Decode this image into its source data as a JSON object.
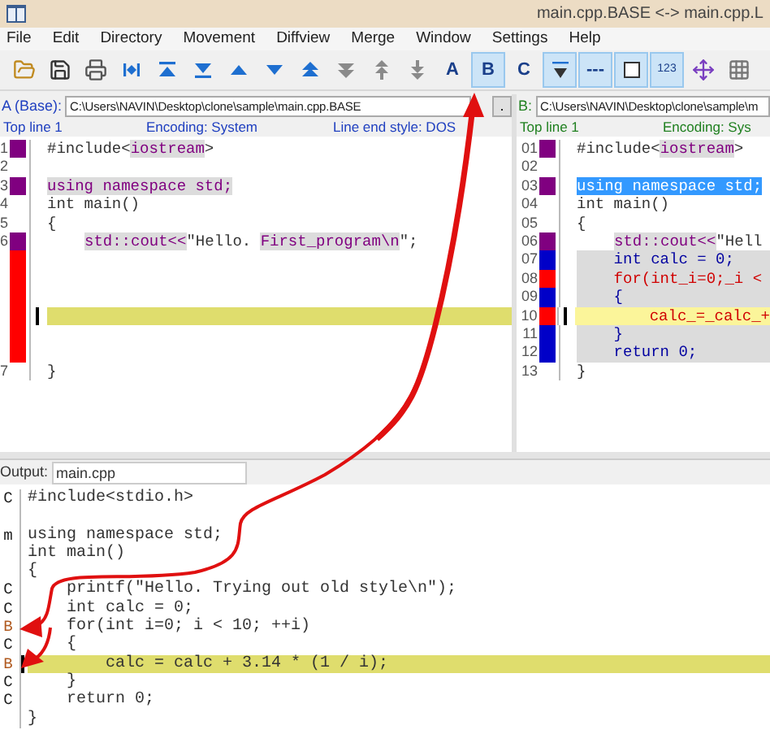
{
  "window": {
    "title": "main.cpp.BASE <-> main.cpp.L"
  },
  "menu": [
    "File",
    "Edit",
    "Directory",
    "Movement",
    "Diffview",
    "Merge",
    "Window",
    "Settings",
    "Help"
  ],
  "toolbar": [
    {
      "kind": "open",
      "selected": false
    },
    {
      "kind": "save",
      "selected": false
    },
    {
      "kind": "print",
      "selected": false
    },
    {
      "kind": "current",
      "selected": false
    },
    {
      "kind": "top",
      "selected": false
    },
    {
      "kind": "bottom",
      "selected": false
    },
    {
      "kind": "prev",
      "selected": false
    },
    {
      "kind": "next",
      "selected": false
    },
    {
      "kind": "prev-conflict",
      "selected": false
    },
    {
      "kind": "next-conflict",
      "selected": false
    },
    {
      "kind": "prev-unsolved",
      "selected": false
    },
    {
      "kind": "next-unsolved",
      "selected": false
    },
    {
      "kind": "letter",
      "label": "A",
      "selected": false
    },
    {
      "kind": "letter",
      "label": "B",
      "selected": true
    },
    {
      "kind": "letter",
      "label": "C",
      "selected": false
    },
    {
      "kind": "auto",
      "selected": true
    },
    {
      "kind": "letter",
      "label": "---",
      "selected": true
    },
    {
      "kind": "square",
      "selected": true
    },
    {
      "kind": "small",
      "label": "123",
      "selected": true
    },
    {
      "kind": "move",
      "selected": false
    },
    {
      "kind": "grid",
      "selected": false
    }
  ],
  "pane_a": {
    "label": "A (Base):",
    "path": "C:\\Users\\NAVIN\\Desktop\\clone\\sample\\main.cpp.BASE",
    "browse": ".",
    "top_line": "Top line 1",
    "encoding": "Encoding: System",
    "line_end": "Line end style: DOS",
    "lines": [
      {
        "number": "1",
        "color": "#800080",
        "current": false,
        "shaded": false,
        "indented": false,
        "segments": [
          {
            "text": "#include<",
            "kind": "plain"
          },
          {
            "text": "iostream",
            "kind": "diff"
          },
          {
            "text": ">",
            "kind": "plain"
          }
        ]
      },
      {
        "number": "2",
        "current": false,
        "shaded": false
      },
      {
        "number": "3",
        "color": "#800080",
        "current": false,
        "shaded": false,
        "indented": false,
        "segments": [
          {
            "text": "using namespace std;",
            "kind": "diff"
          }
        ]
      },
      {
        "number": "4",
        "current": false,
        "shaded": false,
        "indented": false,
        "segments": [
          {
            "text": "int main()",
            "kind": "plain"
          }
        ]
      },
      {
        "number": "5",
        "current": false,
        "shaded": false,
        "indented": false,
        "segments": [
          {
            "text": "{",
            "kind": "plain"
          }
        ]
      },
      {
        "number": "6",
        "color": "#800080",
        "current": false,
        "shaded": false,
        "indented": true,
        "segments": [
          {
            "text": "std::cout<<",
            "kind": "diff"
          },
          {
            "text": "\"Hello. ",
            "kind": "plain"
          },
          {
            "text": "First_program\\n",
            "kind": "diff"
          },
          {
            "text": "\";",
            "kind": "plain"
          }
        ]
      },
      {
        "color": "#ff0000",
        "current": false,
        "shaded": false
      },
      {
        "color": "#ff0000",
        "current": false,
        "shaded": false
      },
      {
        "color": "#ff0000",
        "current": false,
        "shaded": false
      },
      {
        "color": "#ff0000",
        "current": true,
        "shaded": false
      },
      {
        "color": "#ff0000",
        "current": false,
        "shaded": false
      },
      {
        "color": "#ff0000",
        "current": false,
        "shaded": false
      },
      {
        "number": "7",
        "current": false,
        "shaded": false,
        "indented": false,
        "segments": [
          {
            "text": "}",
            "kind": "plain"
          }
        ]
      }
    ]
  },
  "pane_b": {
    "label": "B:",
    "path": "C:\\Users\\NAVIN\\Desktop\\clone\\sample\\m",
    "top_line": "Top line 1",
    "encoding": "Encoding: Sys",
    "lines": [
      {
        "number": "01",
        "color": "#800080",
        "current": false,
        "shaded": false,
        "indented": false,
        "segments": [
          {
            "text": "#include<",
            "kind": "plain"
          },
          {
            "text": "iostream",
            "kind": "diff"
          },
          {
            "text": ">",
            "kind": "plain"
          }
        ]
      },
      {
        "number": "02",
        "current": false,
        "shaded": false
      },
      {
        "number": "03",
        "color": "#800080",
        "current": false,
        "shaded": false,
        "indented": false,
        "segments": [
          {
            "text": "using namespace std;",
            "kind": "selection"
          }
        ]
      },
      {
        "number": "04",
        "current": false,
        "shaded": false,
        "indented": false,
        "segments": [
          {
            "text": "int main()",
            "kind": "plain"
          }
        ]
      },
      {
        "number": "05",
        "current": false,
        "shaded": false,
        "indented": false,
        "segments": [
          {
            "text": "{",
            "kind": "plain"
          }
        ]
      },
      {
        "number": "06",
        "color": "#800080",
        "current": false,
        "shaded": false,
        "indented": true,
        "segments": [
          {
            "text": "std::cout<<",
            "kind": "diff"
          },
          {
            "text": "\"Hell",
            "kind": "plain"
          }
        ]
      },
      {
        "number": "07",
        "color": "#0000c8",
        "current": false,
        "shaded": true,
        "indented": false,
        "segments": [
          {
            "text": "    int calc = 0;",
            "kind": "added"
          }
        ]
      },
      {
        "number": "08",
        "color": "#ff0000",
        "current": false,
        "shaded": true,
        "indented": false,
        "segments": [
          {
            "text": "    for(int_i=0;_i <",
            "kind": "conflict"
          }
        ]
      },
      {
        "number": "09",
        "color": "#0000c8",
        "current": false,
        "shaded": true,
        "indented": false,
        "segments": [
          {
            "text": "    {",
            "kind": "added"
          }
        ]
      },
      {
        "number": "10",
        "color": "#ff0000",
        "current": true,
        "shaded": true,
        "indented": false,
        "segments": [
          {
            "text": "        calc_=_calc_+",
            "kind": "conflict"
          }
        ]
      },
      {
        "number": "11",
        "color": "#0000c8",
        "current": false,
        "shaded": true,
        "indented": false,
        "segments": [
          {
            "text": "    }",
            "kind": "added"
          }
        ]
      },
      {
        "number": "12",
        "color": "#0000c8",
        "current": false,
        "shaded": true,
        "indented": false,
        "segments": [
          {
            "text": "    return 0;",
            "kind": "added"
          }
        ]
      },
      {
        "number": "13",
        "current": false,
        "shaded": false,
        "indented": false,
        "segments": [
          {
            "text": "}",
            "kind": "plain"
          }
        ]
      }
    ]
  },
  "output": {
    "label": "Output:",
    "file": "main.cpp",
    "lines": [
      {
        "source": "C",
        "color": "#202020",
        "text": "#include<stdio.h>",
        "current": false
      },
      {
        "current": false
      },
      {
        "source": "m",
        "color": "#202020",
        "text": "using namespace std;",
        "current": false
      },
      {
        "text": "int main()",
        "current": false
      },
      {
        "text": "{",
        "current": false
      },
      {
        "source": "C",
        "color": "#202020",
        "text": "    printf(\"Hello. Trying out old style\\n\");",
        "current": false
      },
      {
        "source": "C",
        "color": "#202020",
        "text": "    int calc = 0;",
        "current": false
      },
      {
        "source": "B",
        "color": "#b05a20",
        "text": "    for(int i=0; i < 10; ++i)",
        "current": false
      },
      {
        "source": "C",
        "color": "#202020",
        "text": "    {",
        "current": false
      },
      {
        "source": "B",
        "color": "#b05a20",
        "text": "        calc = calc + 3.14 * (1 / i);",
        "current": true
      },
      {
        "source": "C",
        "color": "#202020",
        "text": "    }",
        "current": false
      },
      {
        "source": "C",
        "color": "#202020",
        "text": "    return 0;",
        "current": false
      },
      {
        "text": "}",
        "current": false
      }
    ]
  }
}
